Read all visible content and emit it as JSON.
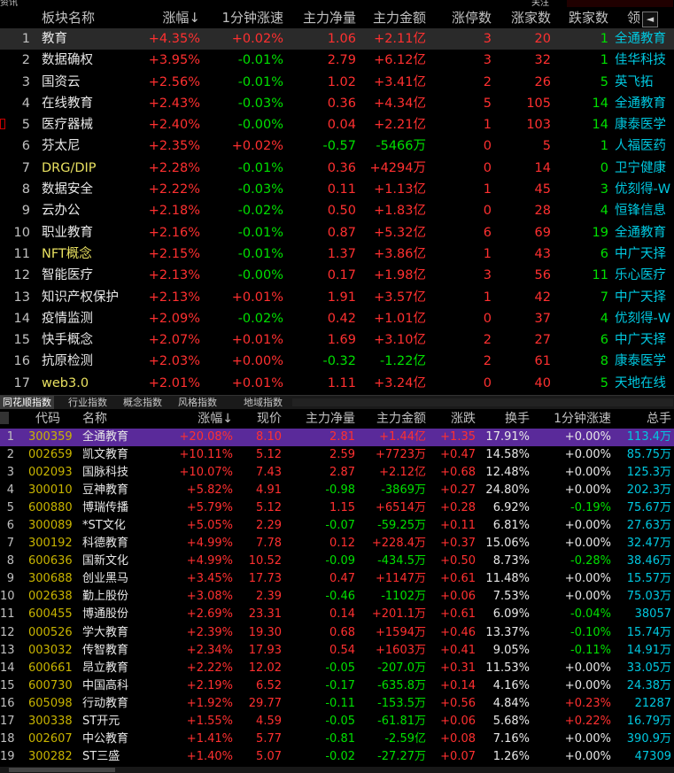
{
  "top_strip": {
    "left_text": "资讯",
    "mid_text": "关注"
  },
  "sector_table": {
    "headers": {
      "name": "板块名称",
      "change": "涨幅",
      "speed": "1分钟涨速",
      "net_flow": "主力净量",
      "amount": "主力金额",
      "limit_up": "涨停数",
      "up_count": "涨家数",
      "down_count": "跌家数",
      "leader": "领"
    },
    "rows": [
      {
        "idx": "1",
        "name": "教育",
        "change": "+4.35%",
        "speed": "+0.02%",
        "net": "1.06",
        "amount": "+2.11亿",
        "limit": "3",
        "ups": "20",
        "downs": "1",
        "leader": "全通教育",
        "speed_c": "red",
        "net_c": "red",
        "amt_c": "red",
        "lim_c": "red",
        "dn_c": "green"
      },
      {
        "idx": "2",
        "name": "数据确权",
        "change": "+3.95%",
        "speed": "-0.01%",
        "net": "2.79",
        "amount": "+6.12亿",
        "limit": "3",
        "ups": "32",
        "downs": "1",
        "leader": "佳华科技",
        "speed_c": "green",
        "net_c": "red",
        "amt_c": "red",
        "lim_c": "red",
        "dn_c": "green"
      },
      {
        "idx": "3",
        "name": "国资云",
        "change": "+2.56%",
        "speed": "-0.01%",
        "net": "1.02",
        "amount": "+3.41亿",
        "limit": "2",
        "ups": "26",
        "downs": "5",
        "leader": "英飞拓",
        "speed_c": "green",
        "net_c": "red",
        "amt_c": "red",
        "lim_c": "red",
        "dn_c": "green"
      },
      {
        "idx": "4",
        "name": "在线教育",
        "change": "+2.43%",
        "speed": "-0.03%",
        "net": "0.36",
        "amount": "+4.34亿",
        "limit": "5",
        "ups": "105",
        "downs": "14",
        "leader": "全通教育",
        "speed_c": "green",
        "net_c": "red",
        "amt_c": "red",
        "lim_c": "red",
        "dn_c": "green"
      },
      {
        "idx": "5",
        "name": "医疗器械",
        "change": "+2.40%",
        "speed": "-0.00%",
        "net": "0.04",
        "amount": "+2.21亿",
        "limit": "1",
        "ups": "103",
        "downs": "14",
        "leader": "康泰医学",
        "speed_c": "green",
        "net_c": "red",
        "amt_c": "red",
        "lim_c": "red",
        "dn_c": "green"
      },
      {
        "idx": "6",
        "name": "芬太尼",
        "change": "+2.35%",
        "speed": "+0.02%",
        "net": "-0.57",
        "amount": "-5466万",
        "limit": "0",
        "ups": "5",
        "downs": "1",
        "leader": "人福医药",
        "speed_c": "red",
        "net_c": "green",
        "amt_c": "green",
        "lim_c": "red",
        "dn_c": "green"
      },
      {
        "idx": "7",
        "name": "DRG/DIP",
        "change": "+2.28%",
        "speed": "-0.01%",
        "net": "0.36",
        "amount": "+4294万",
        "limit": "0",
        "ups": "14",
        "downs": "0",
        "leader": "卫宁健康",
        "speed_c": "green",
        "net_c": "red",
        "amt_c": "red",
        "lim_c": "red",
        "dn_c": "green"
      },
      {
        "idx": "8",
        "name": "数据安全",
        "change": "+2.22%",
        "speed": "-0.03%",
        "net": "0.11",
        "amount": "+1.13亿",
        "limit": "1",
        "ups": "45",
        "downs": "3",
        "leader": "优刻得-W",
        "speed_c": "green",
        "net_c": "red",
        "amt_c": "red",
        "lim_c": "red",
        "dn_c": "green"
      },
      {
        "idx": "9",
        "name": "云办公",
        "change": "+2.18%",
        "speed": "-0.02%",
        "net": "0.50",
        "amount": "+1.83亿",
        "limit": "0",
        "ups": "28",
        "downs": "4",
        "leader": "恒锋信息",
        "speed_c": "green",
        "net_c": "red",
        "amt_c": "red",
        "lim_c": "red",
        "dn_c": "green"
      },
      {
        "idx": "10",
        "name": "职业教育",
        "change": "+2.16%",
        "speed": "-0.01%",
        "net": "0.87",
        "amount": "+5.32亿",
        "limit": "6",
        "ups": "69",
        "downs": "19",
        "leader": "全通教育",
        "speed_c": "green",
        "net_c": "red",
        "amt_c": "red",
        "lim_c": "red",
        "dn_c": "green"
      },
      {
        "idx": "11",
        "name": "NFT概念",
        "change": "+2.15%",
        "speed": "-0.01%",
        "net": "1.37",
        "amount": "+3.86亿",
        "limit": "1",
        "ups": "43",
        "downs": "6",
        "leader": "中广天择",
        "speed_c": "green",
        "net_c": "red",
        "amt_c": "red",
        "lim_c": "red",
        "dn_c": "green"
      },
      {
        "idx": "12",
        "name": "智能医疗",
        "change": "+2.13%",
        "speed": "-0.00%",
        "net": "0.17",
        "amount": "+1.98亿",
        "limit": "3",
        "ups": "56",
        "downs": "11",
        "leader": "乐心医疗",
        "speed_c": "green",
        "net_c": "red",
        "amt_c": "red",
        "lim_c": "red",
        "dn_c": "green"
      },
      {
        "idx": "13",
        "name": "知识产权保护",
        "change": "+2.13%",
        "speed": "+0.01%",
        "net": "1.91",
        "amount": "+3.57亿",
        "limit": "1",
        "ups": "42",
        "downs": "7",
        "leader": "中广天择",
        "speed_c": "red",
        "net_c": "red",
        "amt_c": "red",
        "lim_c": "red",
        "dn_c": "green"
      },
      {
        "idx": "14",
        "name": "疫情监测",
        "change": "+2.09%",
        "speed": "-0.02%",
        "net": "0.42",
        "amount": "+1.01亿",
        "limit": "0",
        "ups": "37",
        "downs": "4",
        "leader": "优刻得-W",
        "speed_c": "green",
        "net_c": "red",
        "amt_c": "red",
        "lim_c": "red",
        "dn_c": "green"
      },
      {
        "idx": "15",
        "name": "快手概念",
        "change": "+2.07%",
        "speed": "+0.01%",
        "net": "1.69",
        "amount": "+3.10亿",
        "limit": "2",
        "ups": "27",
        "downs": "6",
        "leader": "中广天择",
        "speed_c": "red",
        "net_c": "red",
        "amt_c": "red",
        "lim_c": "red",
        "dn_c": "green"
      },
      {
        "idx": "16",
        "name": "抗原检测",
        "change": "+2.03%",
        "speed": "+0.00%",
        "net": "-0.32",
        "amount": "-1.22亿",
        "limit": "2",
        "ups": "61",
        "downs": "8",
        "leader": "康泰医学",
        "speed_c": "red",
        "net_c": "green",
        "amt_c": "green",
        "lim_c": "red",
        "dn_c": "green"
      },
      {
        "idx": "17",
        "name": "web3.0",
        "change": "+2.01%",
        "speed": "+0.01%",
        "net": "1.11",
        "amount": "+3.24亿",
        "limit": "0",
        "ups": "40",
        "downs": "5",
        "leader": "天地在线",
        "speed_c": "red",
        "net_c": "red",
        "amt_c": "red",
        "lim_c": "red",
        "dn_c": "green"
      }
    ]
  },
  "tabs": [
    "同花顺指数",
    "行业指数",
    "概念指数",
    "风格指数",
    "地域指数"
  ],
  "stock_table": {
    "headers": {
      "code": "代码",
      "name": "名称",
      "change": "涨幅",
      "price": "现价",
      "net_flow": "主力净量",
      "amount": "主力金额",
      "diff": "涨跌",
      "turnover": "换手",
      "speed": "1分钟涨速",
      "total": "总手"
    },
    "rows": [
      {
        "idx": "1",
        "code": "300359",
        "name": "全通教育",
        "change": "+20.08%",
        "price": "8.10",
        "net": "2.81",
        "amount": "+1.44亿",
        "diff": "+1.35",
        "turn": "17.91%",
        "speed": "+0.00%",
        "total": "113.4万",
        "net_c": "red",
        "amt_c": "red",
        "speed_c": "white"
      },
      {
        "idx": "2",
        "code": "002659",
        "name": "凯文教育",
        "change": "+10.11%",
        "price": "5.12",
        "net": "2.59",
        "amount": "+7723万",
        "diff": "+0.47",
        "turn": "14.58%",
        "speed": "+0.00%",
        "total": "85.75万",
        "net_c": "red",
        "amt_c": "red",
        "speed_c": "white"
      },
      {
        "idx": "3",
        "code": "002093",
        "name": "国脉科技",
        "change": "+10.07%",
        "price": "7.43",
        "net": "2.87",
        "amount": "+2.12亿",
        "diff": "+0.68",
        "turn": "12.48%",
        "speed": "+0.00%",
        "total": "125.3万",
        "net_c": "red",
        "amt_c": "red",
        "speed_c": "white"
      },
      {
        "idx": "4",
        "code": "300010",
        "name": "豆神教育",
        "change": "+5.82%",
        "price": "4.91",
        "net": "-0.98",
        "amount": "-3869万",
        "diff": "+0.27",
        "turn": "24.80%",
        "speed": "+0.00%",
        "total": "202.3万",
        "net_c": "green",
        "amt_c": "green",
        "speed_c": "white"
      },
      {
        "idx": "5",
        "code": "600880",
        "name": "博瑞传播",
        "change": "+5.79%",
        "price": "5.12",
        "net": "1.15",
        "amount": "+6514万",
        "diff": "+0.28",
        "turn": "6.92%",
        "speed": "-0.19%",
        "total": "75.67万",
        "net_c": "red",
        "amt_c": "red",
        "speed_c": "green"
      },
      {
        "idx": "6",
        "code": "300089",
        "name": "*ST文化",
        "change": "+5.05%",
        "price": "2.29",
        "net": "-0.07",
        "amount": "-59.25万",
        "diff": "+0.11",
        "turn": "6.81%",
        "speed": "+0.00%",
        "total": "27.63万",
        "net_c": "green",
        "amt_c": "green",
        "speed_c": "white"
      },
      {
        "idx": "7",
        "code": "300192",
        "name": "科德教育",
        "change": "+4.99%",
        "price": "7.78",
        "net": "0.12",
        "amount": "+228.4万",
        "diff": "+0.37",
        "turn": "15.06%",
        "speed": "+0.00%",
        "total": "32.47万",
        "net_c": "red",
        "amt_c": "red",
        "speed_c": "white"
      },
      {
        "idx": "8",
        "code": "600636",
        "name": "国新文化",
        "change": "+4.99%",
        "price": "10.52",
        "net": "-0.09",
        "amount": "-434.5万",
        "diff": "+0.50",
        "turn": "8.73%",
        "speed": "-0.28%",
        "total": "38.46万",
        "net_c": "green",
        "amt_c": "green",
        "speed_c": "green"
      },
      {
        "idx": "9",
        "code": "300688",
        "name": "创业黑马",
        "change": "+3.45%",
        "price": "17.73",
        "net": "0.47",
        "amount": "+1147万",
        "diff": "+0.61",
        "turn": "11.48%",
        "speed": "+0.00%",
        "total": "15.57万",
        "net_c": "red",
        "amt_c": "red",
        "speed_c": "white"
      },
      {
        "idx": "10",
        "code": "002638",
        "name": "勤上股份",
        "change": "+3.08%",
        "price": "2.39",
        "net": "-0.46",
        "amount": "-1102万",
        "diff": "+0.06",
        "turn": "7.53%",
        "speed": "+0.00%",
        "total": "75.03万",
        "net_c": "green",
        "amt_c": "green",
        "speed_c": "white"
      },
      {
        "idx": "11",
        "code": "600455",
        "name": "博通股份",
        "change": "+2.69%",
        "price": "23.31",
        "net": "0.14",
        "amount": "+201.1万",
        "diff": "+0.61",
        "turn": "6.09%",
        "speed": "-0.04%",
        "total": "38057",
        "net_c": "red",
        "amt_c": "red",
        "speed_c": "green"
      },
      {
        "idx": "12",
        "code": "000526",
        "name": "学大教育",
        "change": "+2.39%",
        "price": "19.30",
        "net": "0.68",
        "amount": "+1594万",
        "diff": "+0.46",
        "turn": "13.37%",
        "speed": "-0.10%",
        "total": "15.74万",
        "net_c": "red",
        "amt_c": "red",
        "speed_c": "green"
      },
      {
        "idx": "13",
        "code": "003032",
        "name": "传智教育",
        "change": "+2.34%",
        "price": "17.93",
        "net": "0.54",
        "amount": "+1603万",
        "diff": "+0.41",
        "turn": "9.05%",
        "speed": "-0.11%",
        "total": "14.91万",
        "net_c": "red",
        "amt_c": "red",
        "speed_c": "green"
      },
      {
        "idx": "14",
        "code": "600661",
        "name": "昂立教育",
        "change": "+2.22%",
        "price": "12.02",
        "net": "-0.05",
        "amount": "-207.0万",
        "diff": "+0.31",
        "turn": "11.53%",
        "speed": "+0.00%",
        "total": "33.05万",
        "net_c": "green",
        "amt_c": "green",
        "speed_c": "white"
      },
      {
        "idx": "15",
        "code": "600730",
        "name": "中国高科",
        "change": "+2.19%",
        "price": "6.52",
        "net": "-0.17",
        "amount": "-635.8万",
        "diff": "+0.14",
        "turn": "4.16%",
        "speed": "+0.00%",
        "total": "24.38万",
        "net_c": "green",
        "amt_c": "green",
        "speed_c": "white"
      },
      {
        "idx": "16",
        "code": "605098",
        "name": "行动教育",
        "change": "+1.92%",
        "price": "29.77",
        "net": "-0.11",
        "amount": "-153.5万",
        "diff": "+0.56",
        "turn": "4.84%",
        "speed": "+0.23%",
        "total": "21287",
        "net_c": "green",
        "amt_c": "green",
        "speed_c": "red"
      },
      {
        "idx": "17",
        "code": "300338",
        "name": "ST开元",
        "change": "+1.55%",
        "price": "4.59",
        "net": "-0.05",
        "amount": "-61.81万",
        "diff": "+0.06",
        "turn": "5.68%",
        "speed": "+0.22%",
        "total": "16.79万",
        "net_c": "green",
        "amt_c": "green",
        "speed_c": "red"
      },
      {
        "idx": "18",
        "code": "002607",
        "name": "中公教育",
        "change": "+1.41%",
        "price": "5.77",
        "net": "-0.81",
        "amount": "-2.59亿",
        "diff": "+0.08",
        "turn": "7.16%",
        "speed": "+0.00%",
        "total": "390.9万",
        "net_c": "green",
        "amt_c": "green",
        "speed_c": "white"
      },
      {
        "idx": "19",
        "code": "300282",
        "name": "ST三盛",
        "change": "+1.40%",
        "price": "5.07",
        "net": "-0.02",
        "amount": "-27.27万",
        "diff": "+0.07",
        "turn": "1.26%",
        "speed": "+0.00%",
        "total": "47309",
        "net_c": "green",
        "amt_c": "green",
        "speed_c": "white"
      }
    ]
  },
  "colors": {
    "up": "#ff3030",
    "down": "#00e000",
    "leader": "#00c8e0",
    "code": "#c8b400",
    "selected_row_bottom": "#5a2a9a"
  }
}
